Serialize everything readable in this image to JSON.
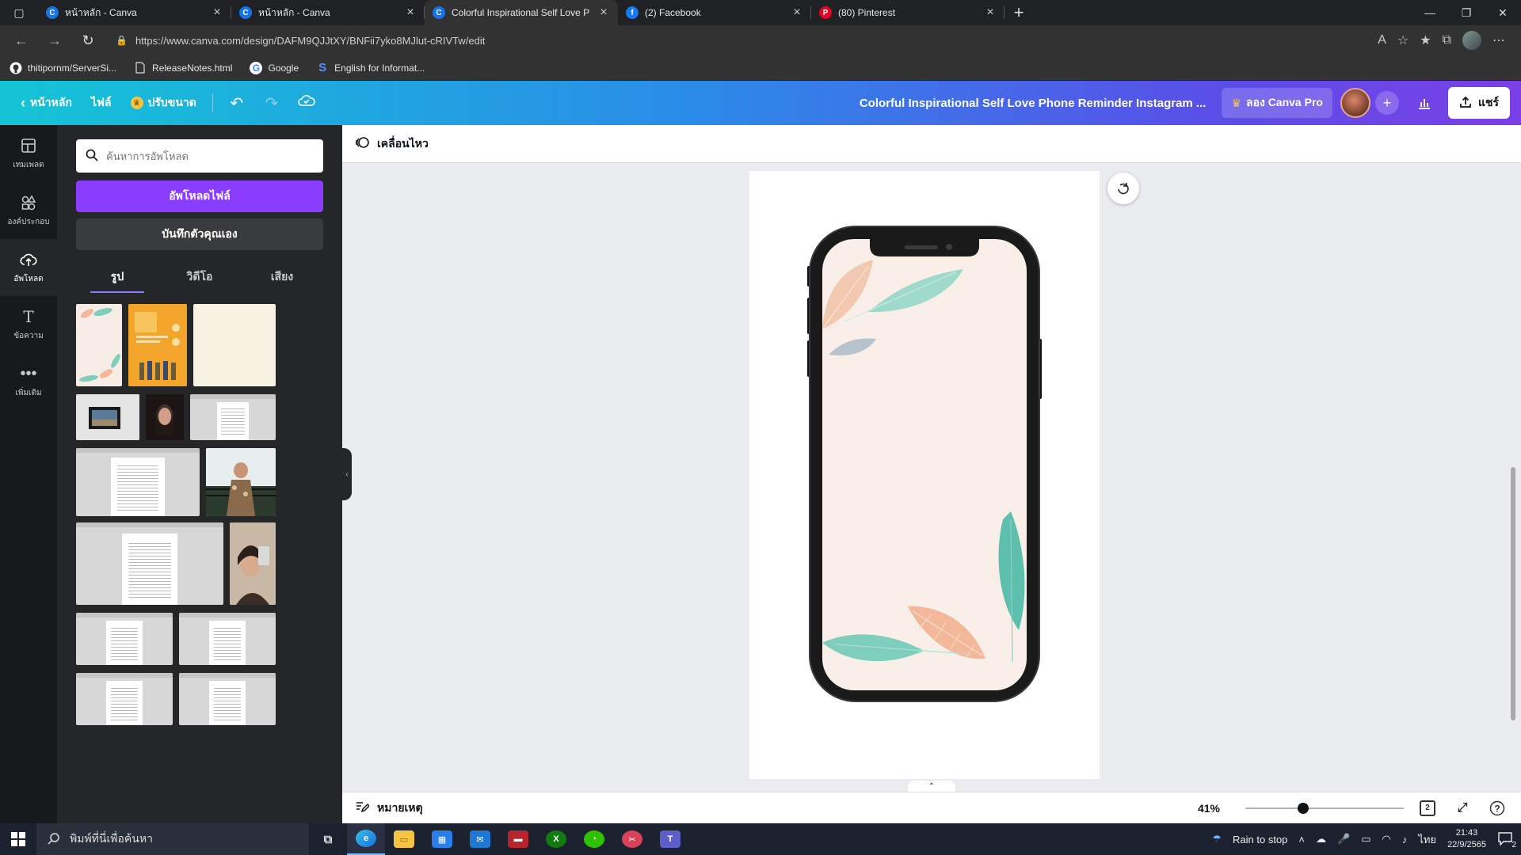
{
  "browser": {
    "tabs": [
      {
        "title": "หน้าหลัก - Canva",
        "favicon": "canva-icon",
        "color": "#1773ea",
        "active": false
      },
      {
        "title": "หน้าหลัก - Canva",
        "favicon": "canva-icon",
        "color": "#1773ea",
        "active": false
      },
      {
        "title": "Colorful Inspirational Self Love P",
        "favicon": "canva-icon",
        "color": "#1773ea",
        "active": true
      },
      {
        "title": "(2) Facebook",
        "favicon": "facebook-icon",
        "color": "#1877f2",
        "active": false
      },
      {
        "title": "(80) Pinterest",
        "favicon": "pinterest-icon",
        "color": "#e60023",
        "active": false
      }
    ],
    "url": "https://www.canva.com/design/DAFM9QJJtXY/BNFii7yko8MJlut-cRIVTw/edit",
    "bookmarks": [
      {
        "label": "thitipornm/ServerSi...",
        "icon": "github-icon"
      },
      {
        "label": "ReleaseNotes.html",
        "icon": "file-icon"
      },
      {
        "label": "Google",
        "icon": "google-icon"
      },
      {
        "label": "English for Informat...",
        "icon": "s-icon"
      }
    ]
  },
  "header": {
    "home": "หน้าหลัก",
    "file": "ไฟล์",
    "resize": "ปรับขนาด",
    "doc_title": "Colorful Inspirational Self Love Phone Reminder Instagram ...",
    "try_pro": "ลอง Canva Pro",
    "share": "แชร์"
  },
  "rail": [
    {
      "label": "เทมเพลต",
      "icon": "template-icon",
      "active": false
    },
    {
      "label": "องค์ประกอบ",
      "icon": "elements-icon",
      "active": false
    },
    {
      "label": "อัพโหลด",
      "icon": "upload-icon",
      "active": true
    },
    {
      "label": "ข้อความ",
      "icon": "text-icon",
      "active": false
    },
    {
      "label": "เพิ่มเติม",
      "icon": "more-icon",
      "active": false
    }
  ],
  "panel": {
    "search_placeholder": "ค้นหาการอัพโหลด",
    "upload_button": "อัพโหลดไฟล์",
    "record_button": "บันทึกตัวคุณเอง",
    "tabs": [
      "รูป",
      "วิดีโอ",
      "เสียง"
    ]
  },
  "workspace": {
    "animate": "เคลื่อนไหว",
    "notes": "หมายเหตุ",
    "zoom": "41%",
    "zoom_fraction": 0.41,
    "pages": "2"
  },
  "taskbar": {
    "search_placeholder": "พิมพ์ที่นี่เพื่อค้นหา",
    "weather": "Rain to stop",
    "lang": "ไทย",
    "time": "21:43",
    "date": "22/9/2565",
    "notifications": "2"
  },
  "colors": {
    "canva_purple": "#8b3dff",
    "panel_bg": "#252627",
    "rail_bg": "#18191b",
    "phone_screen": "#f9efe8",
    "leaf_teal": "#7fcdbd",
    "leaf_peach": "#f3b89a",
    "leaf_grey": "#b7c3cc"
  }
}
